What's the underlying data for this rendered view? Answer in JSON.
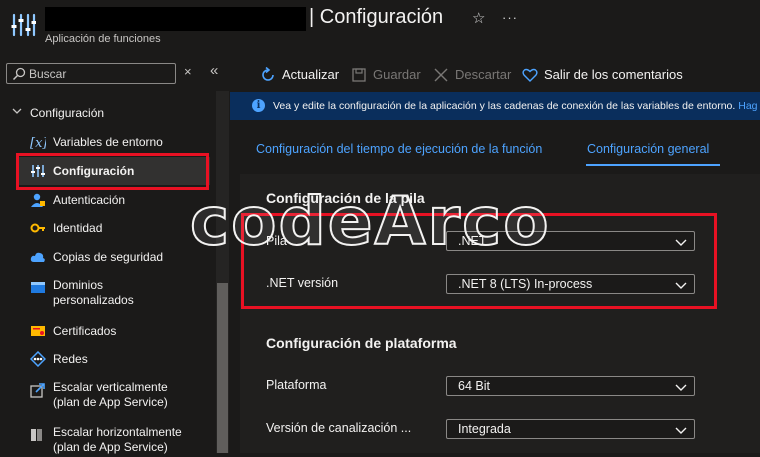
{
  "header": {
    "title": "| Configuración",
    "subtitle": "Aplicación de funciones",
    "star_icon": "star-icon",
    "more_label": "···"
  },
  "sidebar": {
    "search_placeholder": "Buscar",
    "clear_label": "×",
    "collapse_label": "«",
    "group_label": "Configuración",
    "items": [
      {
        "label": "Variables de entorno",
        "icon": "variables-icon"
      },
      {
        "label": "Configuración",
        "icon": "settings-sliders-icon",
        "active": true
      },
      {
        "label": "Autenticación",
        "icon": "user-auth-icon"
      },
      {
        "label": "Identidad",
        "icon": "identity-key-icon"
      },
      {
        "label": "Copias de seguridad",
        "icon": "cloud-backup-icon"
      },
      {
        "label": "Dominios",
        "label2": "personalizados",
        "icon": "domain-icon"
      },
      {
        "label": "Certificados",
        "icon": "certificate-icon"
      },
      {
        "label": "Redes",
        "icon": "network-icon"
      },
      {
        "label": "Escalar verticalmente",
        "label2": "(plan de App Service)",
        "icon": "scale-up-icon"
      },
      {
        "label": "Escalar horizontalmente",
        "label2": "(plan de App Service)",
        "icon": "scale-out-icon"
      }
    ]
  },
  "toolbar": {
    "refresh": "Actualizar",
    "save": "Guardar",
    "discard": "Descartar",
    "feedback": "Salir de los comentarios"
  },
  "info": {
    "text": "Vea y edite la configuración de la aplicación y las cadenas de conexión de las variables de entorno.",
    "link": "Hag"
  },
  "tabs": {
    "runtime": "Configuración del tiempo de ejecución de la función",
    "general": "Configuración general"
  },
  "stack": {
    "title": "Configuración de la pila",
    "stack_label": "Pila",
    "stack_value": ".NET",
    "version_label": ".NET versión",
    "version_value": ".NET 8 (LTS) In-process"
  },
  "platform": {
    "title": "Configuración de plataforma",
    "platform_label": "Plataforma",
    "platform_value": "64 Bit",
    "pipeline_label": "Versión de canalización ...",
    "pipeline_value": "Integrada"
  },
  "watermark": "codeArco",
  "colors": {
    "accent": "#4da3ff",
    "highlight": "#e81123",
    "background": "#1b1a19",
    "info_bar": "#0a2e5c"
  }
}
